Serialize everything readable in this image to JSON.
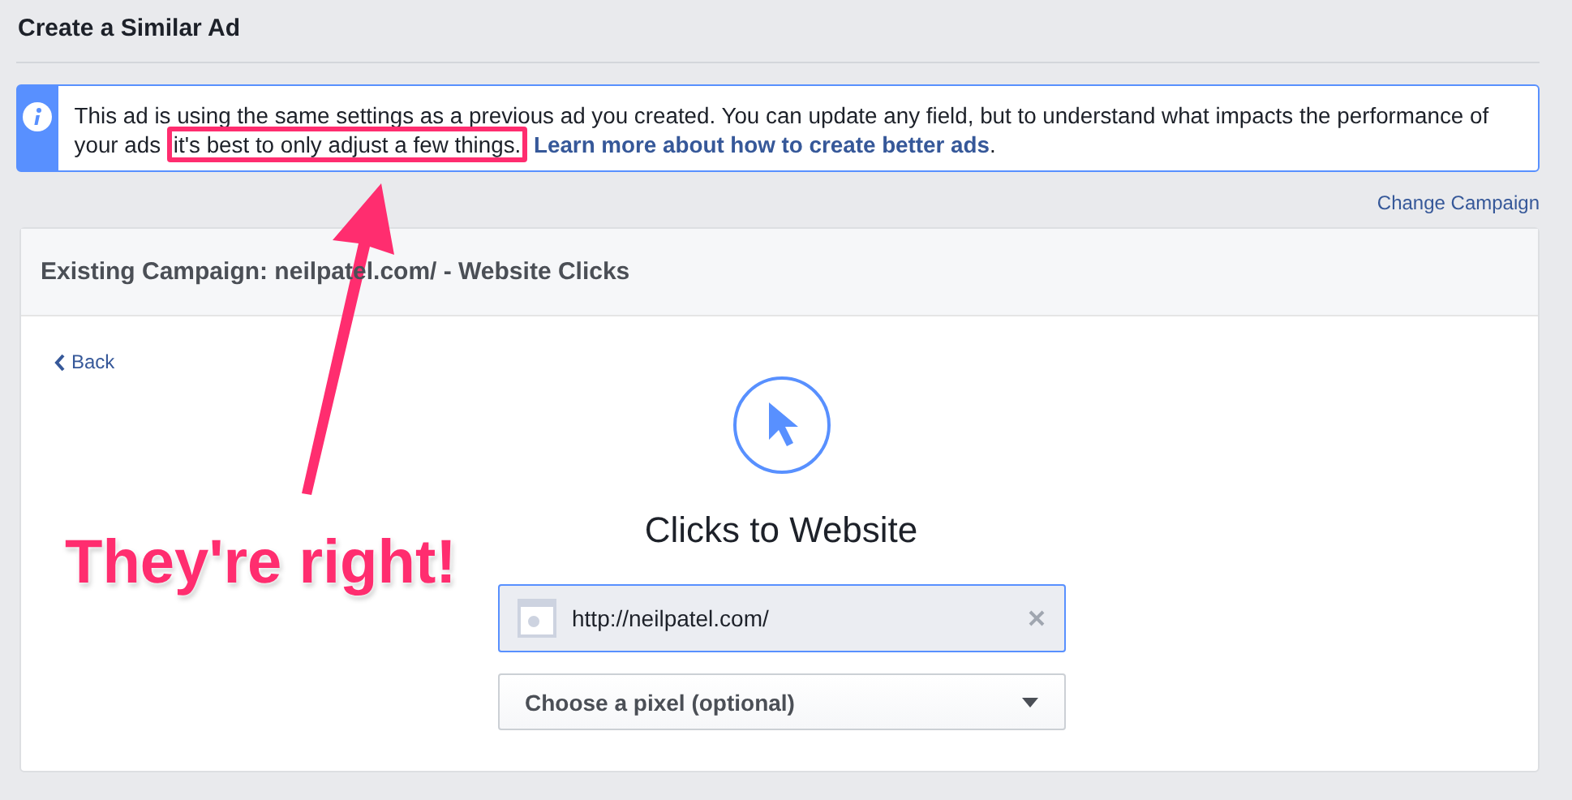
{
  "page_title": "Create a Similar Ad",
  "notice": {
    "text": "This ad is using the same settings as a previous ad you created. You can update any field, but to understand what impacts the performance of your ads",
    "highlighted": "it's best to only adjust a few things.",
    "link": "Learn more about how to create better ads",
    "after": "."
  },
  "change_campaign": "Change Campaign",
  "card": {
    "heading": "Existing Campaign: neilpatel.com/ - Website Clicks",
    "back": "Back",
    "objective": "Clicks to Website",
    "url_field": {
      "value": "http://neilpatel.com/"
    },
    "pixel_select": {
      "placeholder": "Choose a pixel (optional)"
    }
  },
  "annotation": {
    "caption": "They're right!"
  }
}
